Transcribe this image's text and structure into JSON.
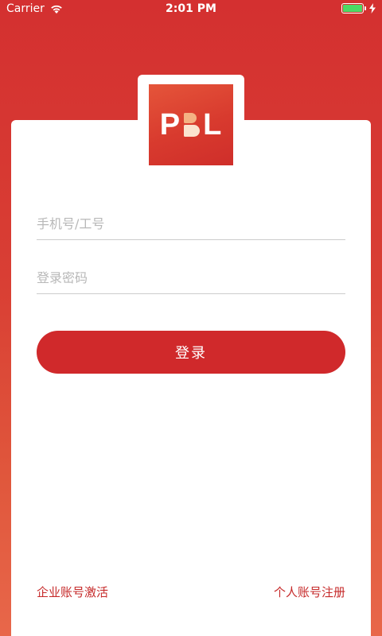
{
  "status_bar": {
    "carrier": "Carrier",
    "time": "2:01 PM",
    "battery_level": 1.0,
    "battery_color": "#4cd964",
    "wifi_icon": "wifi-icon",
    "charge_icon": "charging-bolt-icon"
  },
  "logo": {
    "text_left": "P",
    "text_right": "L",
    "mark_icon": "b-logo-mark"
  },
  "login_form": {
    "phone_placeholder": "手机号/工号",
    "phone_value": "",
    "password_placeholder": "登录密码",
    "password_value": "",
    "submit_label": "登录"
  },
  "footer": {
    "enterprise_activate_label": "企业账号激活",
    "personal_register_label": "个人账号注册"
  },
  "colors": {
    "primary": "#d0292b",
    "link": "#c62a2a",
    "background_top": "#d43030",
    "background_bottom": "#e8674a"
  }
}
